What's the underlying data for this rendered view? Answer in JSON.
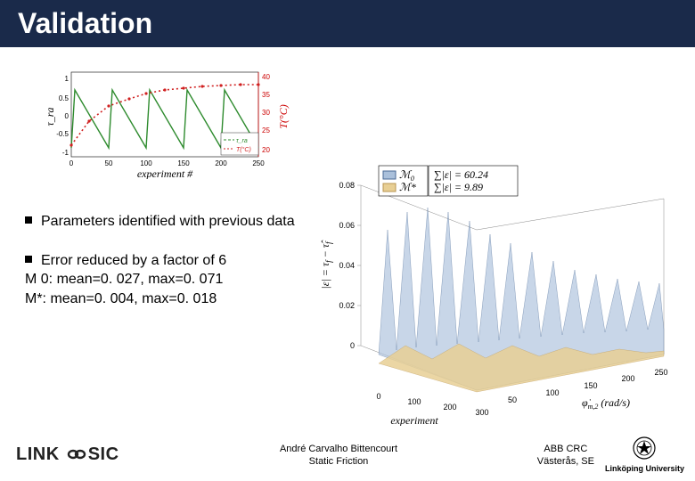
{
  "title": "Validation",
  "bullets": {
    "b1": "Parameters identified with previous data",
    "b2": "Error reduced by a factor of 6",
    "b2_sub1": "M 0: mean=0. 027, max=0. 071",
    "b2_sub2": "M*: mean=0. 004, max=0. 018"
  },
  "top_chart_labels": {
    "xaxis": "experiment #",
    "yaxis_left": "τ_ra",
    "yaxis_right": "T(°C)",
    "legend1": "τ_ra",
    "legend2": "T(°C)"
  },
  "right_plot_labels": {
    "xaxis": "experiment",
    "yaxis": "φ̇_m,2 (rad/s)",
    "zaxis": "|ε| = τ_f − τ̂_f",
    "legend_m0": "ℳ₀",
    "legend_mstar": "ℳ*",
    "sum_m0": "∑|ε| = 60.24",
    "sum_mstar": "∑|ε| = 9.89"
  },
  "footer": {
    "center1": "André Carvalho Bittencourt",
    "center2": "Static Friction",
    "right1": "ABB CRC",
    "right2": "Västerås, SE",
    "liu": "Linköping University"
  },
  "chart_data": [
    {
      "type": "line",
      "title": "Validation experiment trace",
      "xlabel": "experiment #",
      "ylabel_left": "τ_ra",
      "ylabel_right": "T(°C)",
      "xlim": [
        0,
        250
      ],
      "ylim_left": [
        -1,
        1
      ],
      "ylim_right": [
        20,
        40
      ],
      "series": [
        {
          "name": "τ_ra",
          "color": "#2e8b2e",
          "x": [
            0,
            5,
            50,
            55,
            100,
            105,
            150,
            155,
            200,
            205,
            250
          ],
          "y": [
            -0.7,
            0.6,
            -0.7,
            0.6,
            -0.7,
            0.6,
            -0.7,
            0.6,
            -0.7,
            0.6,
            -0.7
          ]
        },
        {
          "name": "T(°C)",
          "color": "#d02020",
          "style": "dotted",
          "x": [
            0,
            25,
            50,
            75,
            100,
            125,
            150,
            175,
            200,
            225,
            250
          ],
          "y_rightaxis": [
            22,
            28,
            32,
            34,
            35,
            36,
            36,
            37,
            37,
            37,
            37
          ]
        }
      ]
    },
    {
      "type": "area",
      "title": "Model residual surfaces |ε|",
      "xlabel": "experiment",
      "ylabel": "φ̇_m,2 (rad/s)",
      "zlabel": "|ε| = τ_f − τ̂_f",
      "xlim": [
        0,
        300
      ],
      "ylim": [
        0,
        300
      ],
      "zlim": [
        0,
        0.08
      ],
      "series": [
        {
          "name": "ℳ₀",
          "color": "#9fb8d8",
          "sum_abs_eps": 60.24
        },
        {
          "name": "ℳ*",
          "color": "#e6c98a",
          "sum_abs_eps": 9.89
        }
      ]
    }
  ]
}
